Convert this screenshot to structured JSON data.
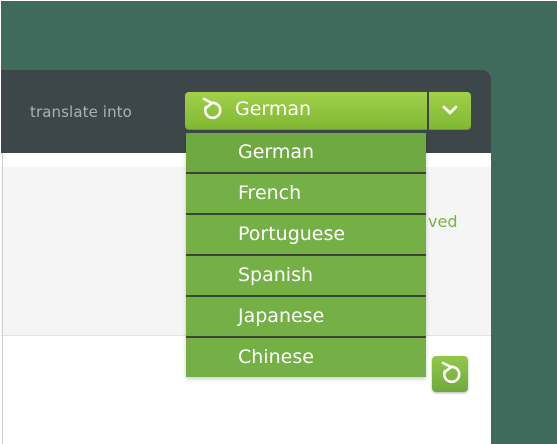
{
  "translate": {
    "label": "translate into",
    "selected_language": "German",
    "options": [
      "German",
      "French",
      "Portuguese",
      "Spanish",
      "Japanese",
      "Chinese"
    ]
  },
  "content": {
    "partial_status_text": "ved"
  },
  "icons": {
    "select_refresh": "refresh-icon",
    "dropdown_caret": "chevron-down-icon",
    "reset": "refresh-icon"
  },
  "colors": {
    "page_background": "#3f6b5d",
    "header_background": "#3d4749",
    "accent_green": "#8ec73b",
    "option_green": "#75b046",
    "label_gray": "#a9b2b3"
  }
}
